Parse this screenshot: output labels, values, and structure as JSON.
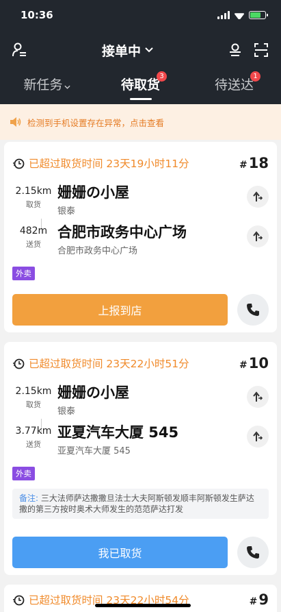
{
  "status_bar": {
    "time": "10:36"
  },
  "header": {
    "title": "接单中"
  },
  "tabs": [
    {
      "label": "新任务",
      "badge": ""
    },
    {
      "label": "待取货",
      "badge": "3"
    },
    {
      "label": "待送达",
      "badge": "1"
    }
  ],
  "notice": {
    "text": "检测到手机设置存在异常，点击查看"
  },
  "orders": [
    {
      "overdue": "已超过取货时间 23天19小时11分",
      "number": "18",
      "pickup": {
        "distance": "2.15km",
        "label": "取货",
        "name": "姗姗の小屋",
        "sub": "银泰"
      },
      "delivery": {
        "distance": "482m",
        "label": "送货",
        "name": "合肥市政务中心广场",
        "sub": "合肥市政务中心广场"
      },
      "tag": "外卖",
      "action": "上报到店"
    },
    {
      "overdue": "已超过取货时间 23天22小时51分",
      "number": "10",
      "pickup": {
        "distance": "2.15km",
        "label": "取货",
        "name": "姗姗の小屋",
        "sub": "银泰"
      },
      "delivery": {
        "distance": "3.77km",
        "label": "送货",
        "name": "亚夏汽车大厦 545",
        "sub": "亚夏汽车大厦 545"
      },
      "tag": "外卖",
      "note_label": "备注:",
      "note": "三大法师萨达撒撒旦法士大夫阿斯顿发顺丰阿斯顿发生萨达撒的第三方按时奥术大师发生的范范萨达打发",
      "action": "我已取货"
    },
    {
      "overdue": "已超过取货时间 23天22小时54分",
      "number": "9"
    }
  ],
  "colors": {
    "header_bg": "#22272e",
    "overdue": "#f08a2a",
    "orange_button": "#f2a03e",
    "blue_button": "#4b9ef3",
    "tag": "#8a4de2",
    "badge": "#f2484b"
  }
}
